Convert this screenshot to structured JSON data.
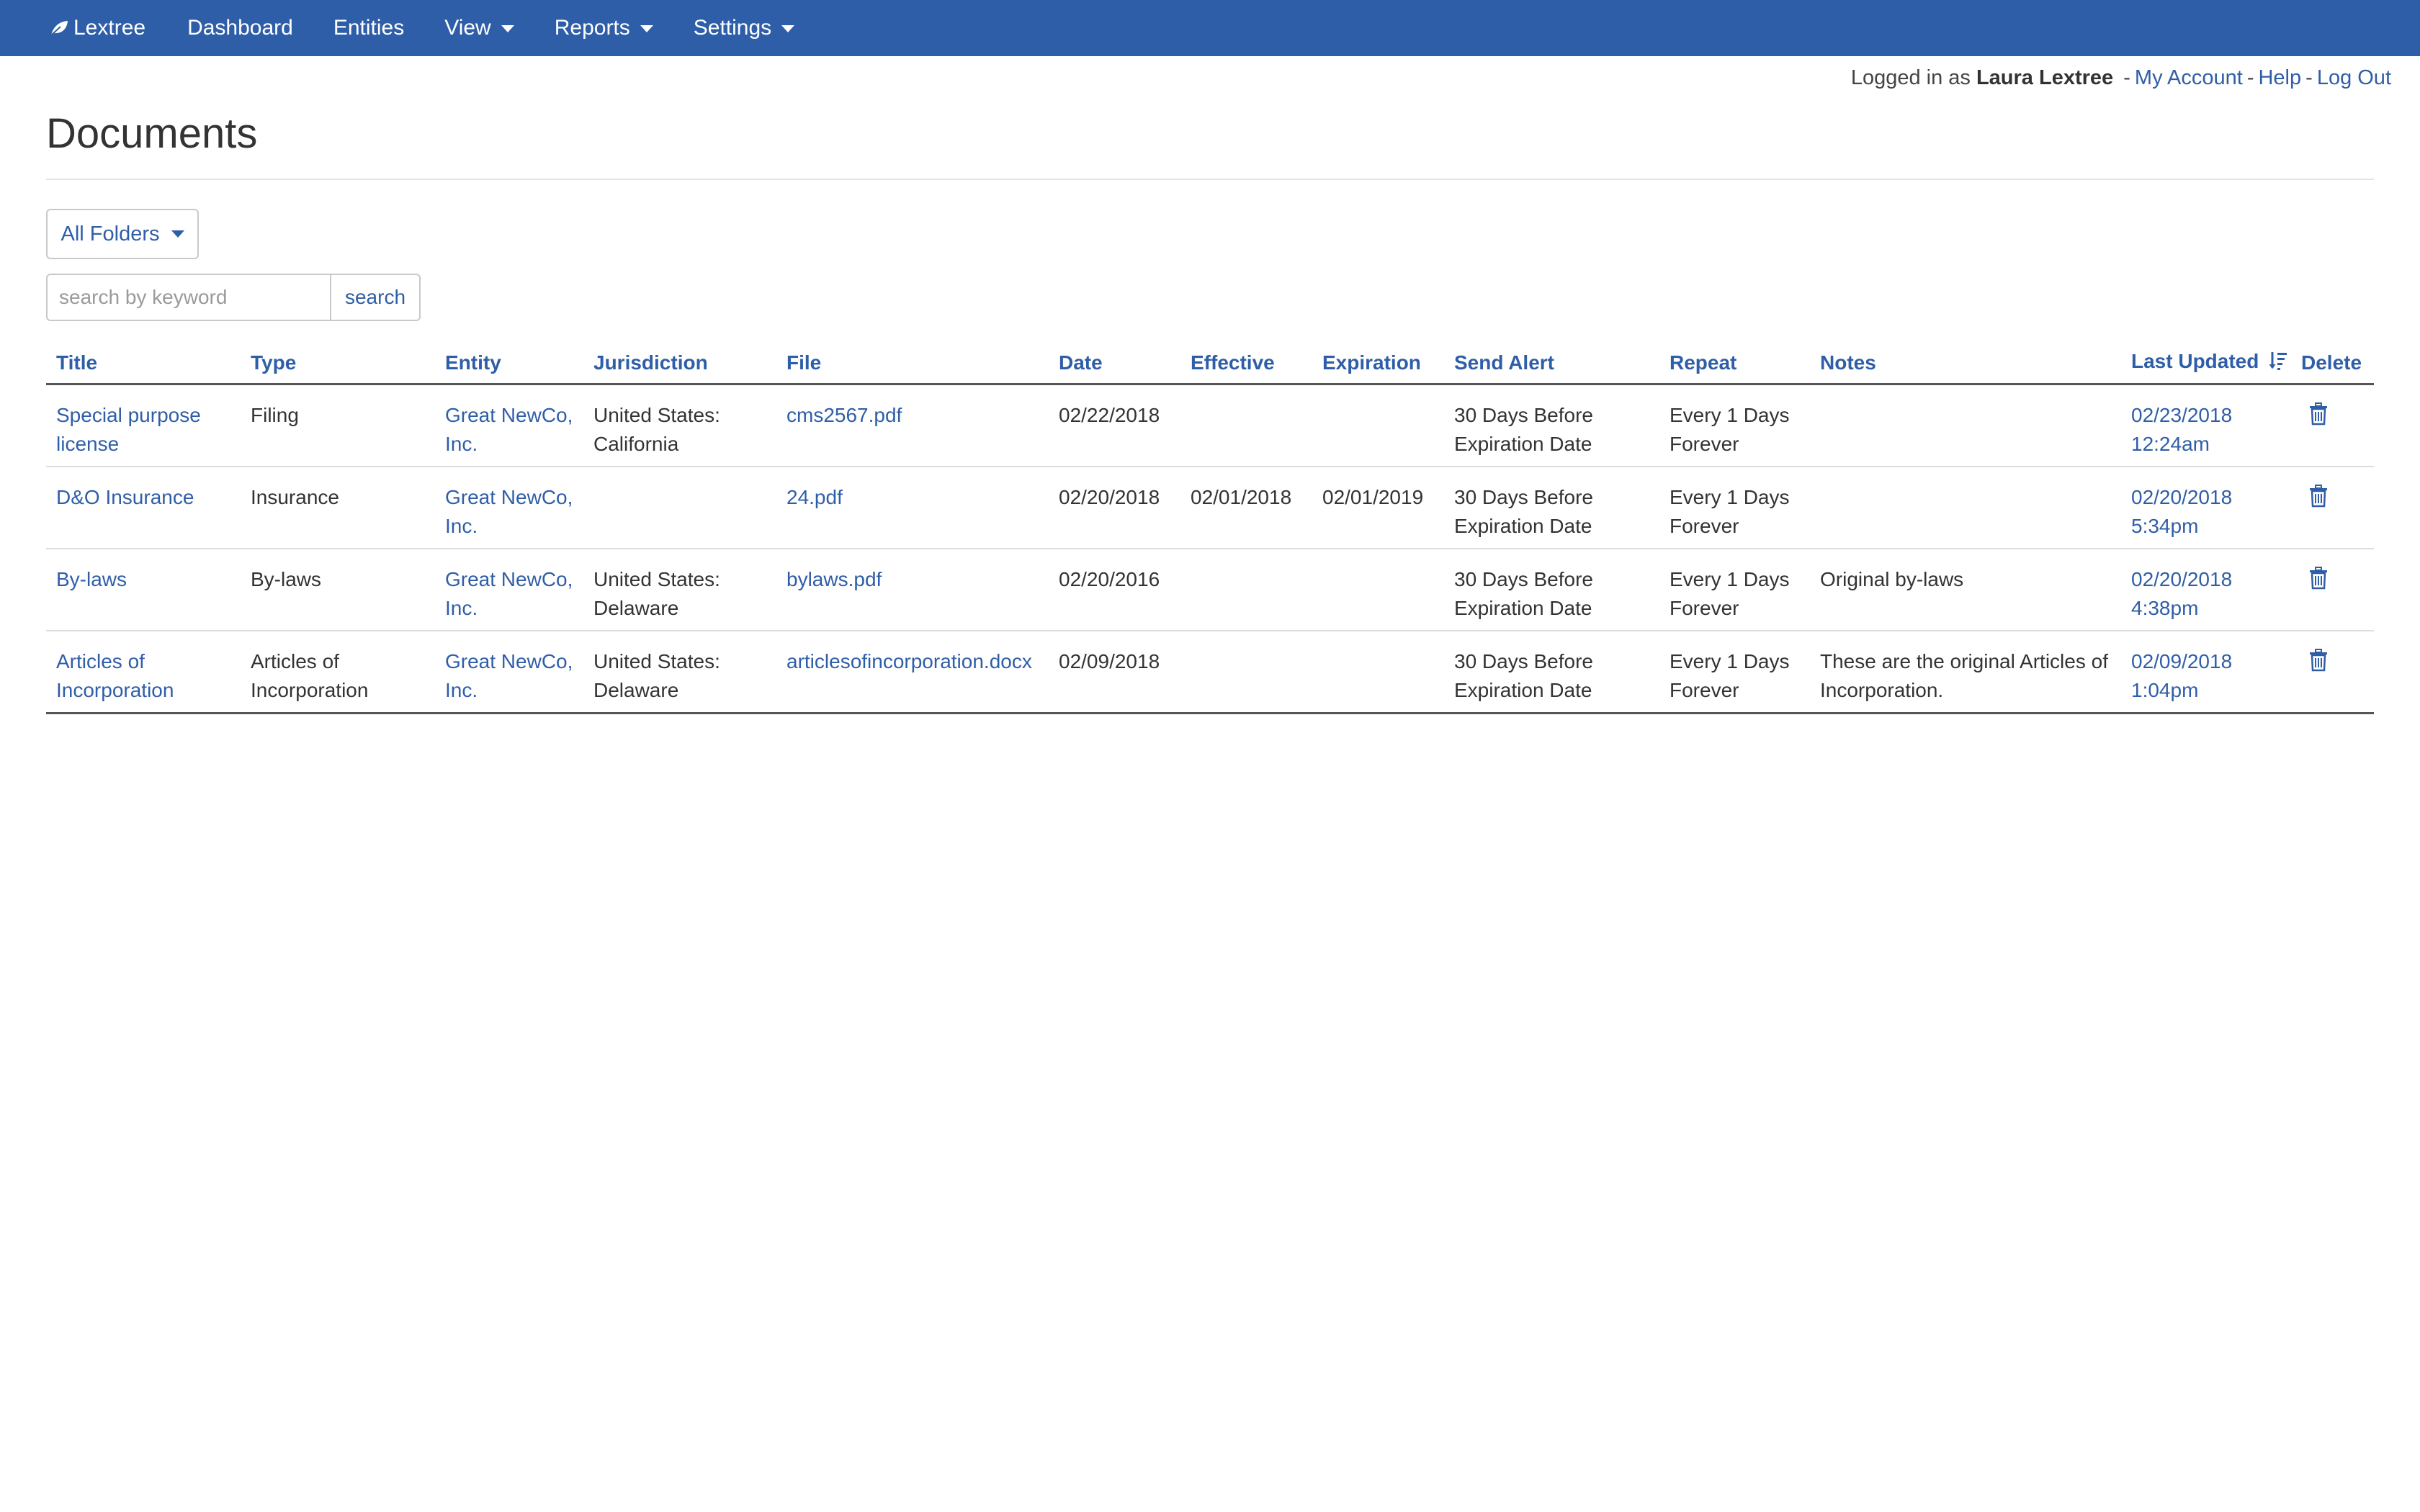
{
  "nav": {
    "brand": "Lextree",
    "items": [
      {
        "label": "Dashboard",
        "dropdown": false
      },
      {
        "label": "Entities",
        "dropdown": false
      },
      {
        "label": "View",
        "dropdown": true
      },
      {
        "label": "Reports",
        "dropdown": true
      },
      {
        "label": "Settings",
        "dropdown": true
      }
    ]
  },
  "userbar": {
    "prefix": "Logged in as",
    "username": "Laura Lextree",
    "sep": "-",
    "links": [
      "My Account",
      "Help",
      "Log Out"
    ]
  },
  "page": {
    "title": "Documents"
  },
  "folder_filter": {
    "selected": "All Folders"
  },
  "search": {
    "placeholder": "search by keyword",
    "value": "",
    "button_label": "search"
  },
  "table": {
    "headers": [
      "Title",
      "Type",
      "Entity",
      "Jurisdiction",
      "File",
      "Date",
      "Effective",
      "Expiration",
      "Send Alert",
      "Repeat",
      "Notes",
      "Last Updated",
      "Delete"
    ],
    "rows": [
      {
        "title": "Special purpose license",
        "type": "Filing",
        "entity": "Great NewCo, Inc.",
        "jurisdiction": "United States: California",
        "file": "cms2567.pdf",
        "date": "02/22/2018",
        "effective": "",
        "expiration": "",
        "send_alert": "30 Days Before Expiration Date",
        "repeat": "Every 1 Days Forever",
        "notes": "",
        "last_updated": "02/23/2018 12:24am"
      },
      {
        "title": "D&O Insurance",
        "type": "Insurance",
        "entity": "Great NewCo, Inc.",
        "jurisdiction": "",
        "file": "24.pdf",
        "date": "02/20/2018",
        "effective": "02/01/2018",
        "expiration": "02/01/2019",
        "send_alert": "30 Days Before Expiration Date",
        "repeat": "Every 1 Days Forever",
        "notes": "",
        "last_updated": "02/20/2018 5:34pm"
      },
      {
        "title": "By-laws",
        "type": "By-laws",
        "entity": "Great NewCo, Inc.",
        "jurisdiction": "United States: Delaware",
        "file": "bylaws.pdf",
        "date": "02/20/2016",
        "effective": "",
        "expiration": "",
        "send_alert": "30 Days Before Expiration Date",
        "repeat": "Every 1 Days Forever",
        "notes": "Original by-laws",
        "last_updated": "02/20/2018 4:38pm"
      },
      {
        "title": "Articles of Incorporation",
        "type": "Articles of Incorporation",
        "entity": "Great NewCo, Inc.",
        "jurisdiction": "United States: Delaware",
        "file": "articlesofincorporation.docx",
        "date": "02/09/2018",
        "effective": "",
        "expiration": "",
        "send_alert": "30 Days Before Expiration Date",
        "repeat": "Every 1 Days Forever",
        "notes": "These are the original Articles of Incorporation.",
        "last_updated": "02/09/2018 1:04pm"
      }
    ]
  },
  "colors": {
    "navbar": "#2f5ea8",
    "link": "#2f5ea8",
    "text": "#333333"
  },
  "icons": {
    "brand": "leaf-icon",
    "sort": "sort-descending-icon",
    "delete": "trash-icon"
  }
}
